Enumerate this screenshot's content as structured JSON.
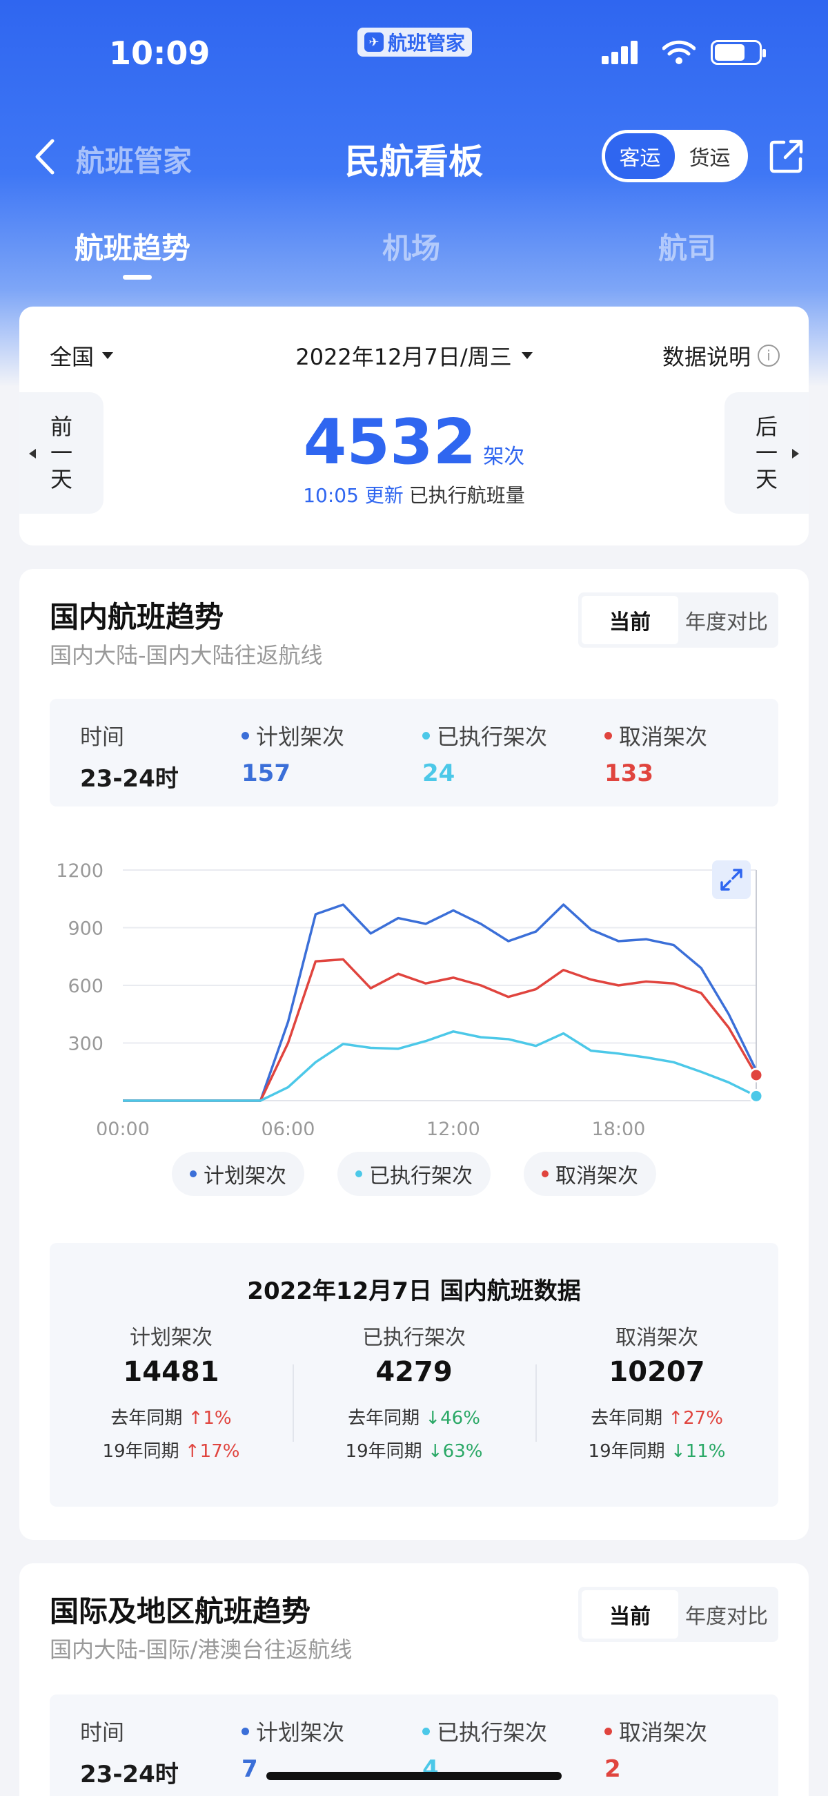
{
  "status": {
    "time": "10:09",
    "app_badge": "航班管家"
  },
  "nav": {
    "back_label": "航班管家",
    "title": "民航看板",
    "mode_options": [
      "客运",
      "货运"
    ],
    "mode_active": "客运"
  },
  "tabs": [
    "航班趋势",
    "机场",
    "航司"
  ],
  "top_card": {
    "region": "全国",
    "date": "2022年12月7日/周三",
    "data_note": "数据说明",
    "prev_day": [
      "前",
      "一",
      "天"
    ],
    "next_day": [
      "后",
      "一",
      "天"
    ],
    "count": "4532",
    "count_unit": "架次",
    "update_time": "10:05 更新",
    "update_desc": "已执行航班量"
  },
  "domestic": {
    "title": "国内航班趋势",
    "subtitle": "国内大陆-国内大陆往返航线",
    "toggle": [
      "当前",
      "年度对比"
    ],
    "stat": {
      "time_label": "时间",
      "time_value": "23-24时",
      "planned_label": "计划架次",
      "planned_value": "157",
      "executed_label": "已执行架次",
      "executed_value": "24",
      "cancelled_label": "取消架次",
      "cancelled_value": "133"
    },
    "legend": [
      "计划架次",
      "已执行架次",
      "取消架次"
    ],
    "summary": {
      "title": "2022年12月7日 国内航班数据",
      "cols": [
        {
          "label": "计划架次",
          "value": "14481",
          "ly_label": "去年同期",
          "ly_dir": "up",
          "ly_value": "↑1%",
          "y19_label": "19年同期",
          "y19_dir": "up",
          "y19_value": "↑17%"
        },
        {
          "label": "已执行架次",
          "value": "4279",
          "ly_label": "去年同期",
          "ly_dir": "down",
          "ly_value": "↓46%",
          "y19_label": "19年同期",
          "y19_dir": "down",
          "y19_value": "↓63%"
        },
        {
          "label": "取消架次",
          "value": "10207",
          "ly_label": "去年同期",
          "ly_dir": "up",
          "ly_value": "↑27%",
          "y19_label": "19年同期",
          "y19_dir": "down",
          "y19_value": "↓11%"
        }
      ]
    }
  },
  "international": {
    "title": "国际及地区航班趋势",
    "subtitle": "国内大陆-国际/港澳台往返航线",
    "toggle": [
      "当前",
      "年度对比"
    ],
    "stat": {
      "time_label": "时间",
      "time_value": "23-24时",
      "planned_label": "计划架次",
      "planned_value": "7",
      "executed_label": "已执行架次",
      "executed_value": "4",
      "cancelled_label": "取消架次",
      "cancelled_value": "2"
    }
  },
  "colors": {
    "brand": "#2f66f0",
    "planned": "#3b6fd8",
    "executed": "#4cc8e8",
    "cancelled": "#e0443e",
    "up": "#e0443e",
    "down": "#2aa866"
  },
  "chart_data": {
    "type": "line",
    "x": [
      0,
      1,
      2,
      3,
      4,
      5,
      6,
      7,
      8,
      9,
      10,
      11,
      12,
      13,
      14,
      15,
      16,
      17,
      18,
      19,
      20,
      21,
      22,
      23
    ],
    "x_tick_labels": [
      "00:00",
      "06:00",
      "12:00",
      "18:00"
    ],
    "x_tick_positions": [
      0,
      6,
      12,
      18
    ],
    "y_ticks": [
      300,
      600,
      900,
      1200
    ],
    "ylim": [
      0,
      1200
    ],
    "grid": true,
    "legend_placement": "bottom-center",
    "series": [
      {
        "name": "计划架次",
        "color": "#3b6fd8",
        "values": [
          0,
          0,
          0,
          0,
          0,
          0,
          410,
          970,
          1020,
          870,
          950,
          920,
          990,
          920,
          830,
          880,
          1020,
          890,
          830,
          840,
          810,
          690,
          450,
          157
        ]
      },
      {
        "name": "取消架次",
        "color": "#e0443e",
        "values": [
          0,
          0,
          0,
          0,
          0,
          0,
          300,
          725,
          735,
          585,
          660,
          610,
          640,
          600,
          540,
          580,
          680,
          630,
          600,
          620,
          610,
          560,
          380,
          133
        ]
      },
      {
        "name": "已执行架次",
        "color": "#4cc8e8",
        "values": [
          0,
          0,
          0,
          0,
          0,
          0,
          70,
          200,
          295,
          275,
          270,
          310,
          360,
          330,
          320,
          285,
          350,
          260,
          245,
          225,
          200,
          150,
          95,
          24
        ]
      }
    ]
  }
}
